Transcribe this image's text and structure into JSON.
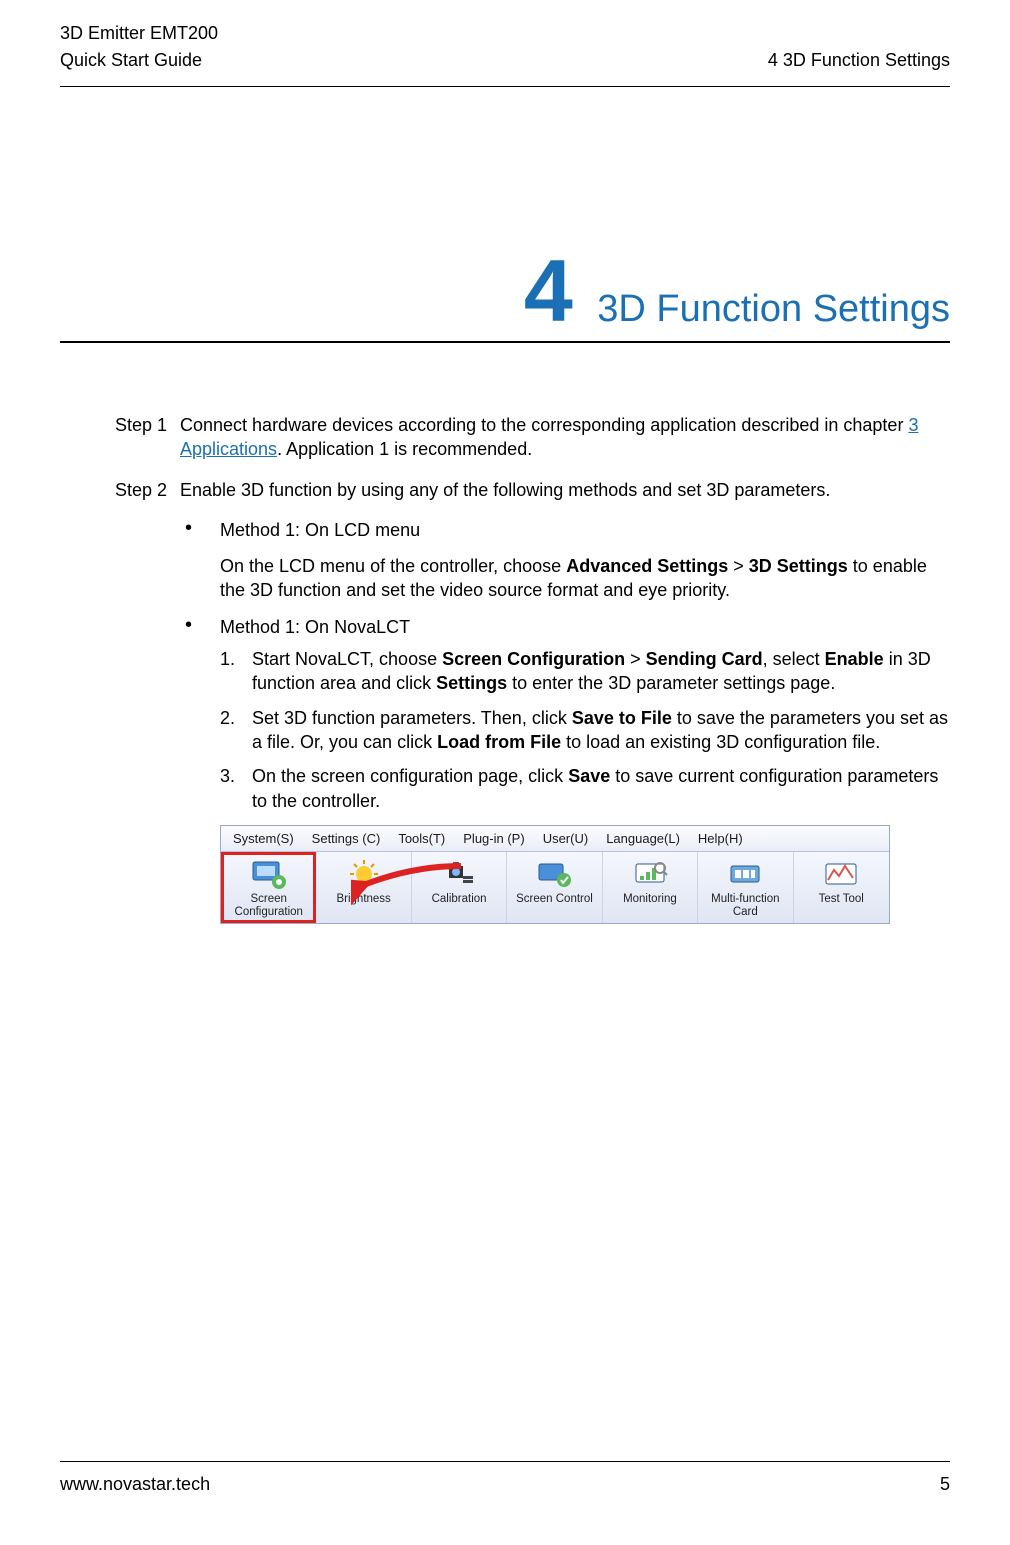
{
  "header": {
    "product": "3D Emitter EMT200",
    "doc": "Quick Start Guide",
    "section": "4 3D Function Settings"
  },
  "chapter": {
    "number": "4",
    "title": "3D Function Settings"
  },
  "steps": {
    "step1_label": "Step 1",
    "step1_pre": "Connect hardware devices according to the corresponding application described in chapter ",
    "step1_link": "3 Applications",
    "step1_post": ". Application 1 is recommended.",
    "step2_label": "Step 2",
    "step2_text": "Enable 3D function by using any of the following methods and set 3D parameters."
  },
  "method1": {
    "title": "Method 1: On LCD menu",
    "desc_pre": "On the LCD menu of the controller, choose ",
    "b1": "Advanced Settings",
    "gt": " > ",
    "b2": "3D Settings",
    "desc_post": " to enable the 3D function and set the video source format and eye priority."
  },
  "method2": {
    "title": "Method 1: On NovaLCT",
    "n1_pre": "Start NovaLCT, choose ",
    "n1_b1": "Screen Configuration",
    "n1_gt": " > ",
    "n1_b2": "Sending Card",
    "n1_mid": ", select ",
    "n1_b3": "Enable",
    "n1_mid2": " in 3D function area and click ",
    "n1_b4": "Settings",
    "n1_post": " to enter the 3D parameter settings page.",
    "n2_pre": "Set 3D function parameters. Then, click ",
    "n2_b1": "Save to File",
    "n2_mid": " to save the parameters you set as a file. Or, you can click ",
    "n2_b2": "Load from File",
    "n2_post": " to load an existing 3D configuration file.",
    "n3_pre": "On the screen configuration page, click ",
    "n3_b1": "Save",
    "n3_post": " to save current configuration parameters to the controller.",
    "m1": "1.",
    "m2": "2.",
    "m3": "3."
  },
  "appshot": {
    "menubar": [
      "System(S)",
      "Settings (C)",
      "Tools(T)",
      "Plug-in (P)",
      "User(U)",
      "Language(L)",
      "Help(H)"
    ],
    "toolbar": [
      "Screen Configuration",
      "Brightness",
      "Calibration",
      "Screen Control",
      "Monitoring",
      "Multi-function Card",
      "Test Tool"
    ]
  },
  "footer": {
    "url": "www.novastar.tech",
    "page": "5"
  }
}
